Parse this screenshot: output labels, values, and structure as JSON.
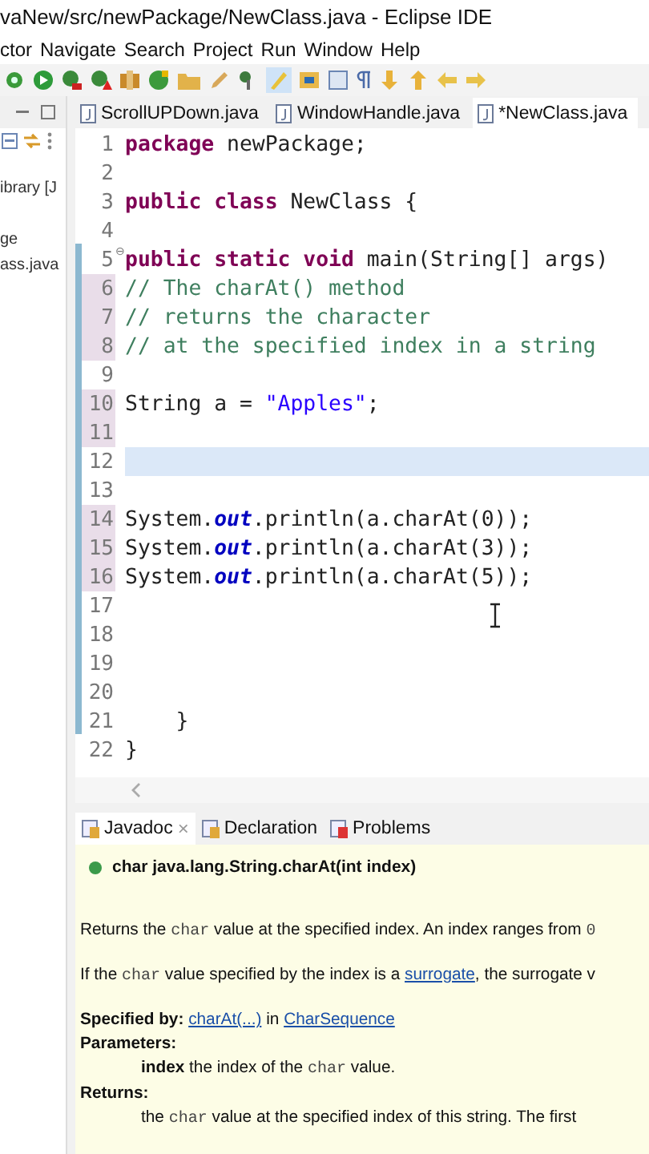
{
  "window": {
    "title": "vaNew/src/newPackage/NewClass.java - Eclipse IDE"
  },
  "menu": [
    "ctor",
    "Navigate",
    "Search",
    "Project",
    "Run",
    "Window",
    "Help"
  ],
  "explorer": {
    "items": [
      "ibrary [J",
      "ge",
      "ass.java"
    ]
  },
  "editor_tabs": [
    {
      "label": "ScrollUPDown.java",
      "selected": false
    },
    {
      "label": "WindowHandle.java",
      "selected": false
    },
    {
      "label": "*NewClass.java",
      "selected": true
    }
  ],
  "code": [
    {
      "number": "1",
      "changed": false,
      "current": false,
      "tokens": [
        {
          "kind": "kw",
          "text": "package"
        },
        {
          "kind": "plain",
          "text": " newPackage;"
        }
      ]
    },
    {
      "number": "2",
      "changed": false,
      "current": false
    },
    {
      "number": "3",
      "changed": false,
      "current": false,
      "tokens": [
        {
          "kind": "kw",
          "text": "public class"
        },
        {
          "kind": "plain",
          "text": " NewClass {"
        }
      ]
    },
    {
      "number": "4",
      "changed": false,
      "current": false
    },
    {
      "number": "5",
      "changed": false,
      "current": false,
      "fold": "⊖",
      "tokens": [
        {
          "kind": "kw",
          "text": "public static void"
        },
        {
          "kind": "plain",
          "text": " main(String[] args)"
        }
      ]
    },
    {
      "number": "6",
      "changed": true,
      "current": false,
      "tokens": [
        {
          "kind": "comment",
          "text": "// The charAt() method"
        }
      ]
    },
    {
      "number": "7",
      "changed": true,
      "current": false,
      "tokens": [
        {
          "kind": "comment",
          "text": "// returns the character"
        }
      ]
    },
    {
      "number": "8",
      "changed": true,
      "current": false,
      "tokens": [
        {
          "kind": "comment",
          "text": "// at the specified index in a string"
        }
      ]
    },
    {
      "number": "9",
      "changed": false,
      "current": false
    },
    {
      "number": "10",
      "changed": true,
      "current": false,
      "tokens": [
        {
          "kind": "plain",
          "text": "String a = "
        },
        {
          "kind": "string",
          "text": "\"Apples\""
        },
        {
          "kind": "plain",
          "text": ";"
        }
      ]
    },
    {
      "number": "11",
      "changed": true,
      "current": false
    },
    {
      "number": "12",
      "changed": false,
      "current": true
    },
    {
      "number": "13",
      "changed": false,
      "current": false
    },
    {
      "number": "14",
      "changed": true,
      "current": false,
      "tokens": [
        {
          "kind": "plain",
          "text": "System."
        },
        {
          "kind": "field",
          "text": "out"
        },
        {
          "kind": "plain",
          "text": ".println(a.charAt(0));"
        }
      ]
    },
    {
      "number": "15",
      "changed": true,
      "current": false,
      "tokens": [
        {
          "kind": "plain",
          "text": "System."
        },
        {
          "kind": "field",
          "text": "out"
        },
        {
          "kind": "plain",
          "text": ".println(a.charAt(3));"
        }
      ]
    },
    {
      "number": "16",
      "changed": true,
      "current": false,
      "tokens": [
        {
          "kind": "plain",
          "text": "System."
        },
        {
          "kind": "field",
          "text": "out"
        },
        {
          "kind": "plain",
          "text": ".println(a.charAt(5));"
        }
      ]
    },
    {
      "number": "17",
      "changed": false,
      "current": false
    },
    {
      "number": "18",
      "changed": false,
      "current": false
    },
    {
      "number": "19",
      "changed": false,
      "current": false
    },
    {
      "number": "20",
      "changed": false,
      "current": false
    },
    {
      "number": "21",
      "changed": false,
      "current": false,
      "tokens": [
        {
          "kind": "plain",
          "text": "    }"
        }
      ]
    },
    {
      "number": "22",
      "changed": false,
      "current": false,
      "tokens": [
        {
          "kind": "plain",
          "text": "}"
        }
      ]
    }
  ],
  "bottom_tabs": [
    {
      "label": "Javadoc",
      "selected": true,
      "close": "×"
    },
    {
      "label": "Declaration",
      "selected": false
    },
    {
      "label": "Problems",
      "selected": false
    }
  ],
  "javadoc": {
    "signature": "char java.lang.String.charAt(int index)",
    "paragraphs": [
      {
        "kind": "text",
        "segments": [
          {
            "kind": "text",
            "text": "Returns the "
          },
          {
            "kind": "code",
            "text": "char"
          },
          {
            "kind": "text",
            "text": " value at the specified index. An index ranges from "
          },
          {
            "kind": "code",
            "text": "0"
          }
        ]
      },
      {
        "kind": "text",
        "segments": [
          {
            "kind": "text",
            "text": "If the "
          },
          {
            "kind": "code",
            "text": "char"
          },
          {
            "kind": "text",
            "text": " value specified by the index is a "
          },
          {
            "kind": "link",
            "text": "surrogate"
          },
          {
            "kind": "text",
            "text": ", the surrogate v"
          }
        ]
      },
      {
        "kind": "heading",
        "segments": [
          {
            "kind": "bold",
            "text": "Specified by: "
          },
          {
            "kind": "link",
            "text": "charAt(...)"
          },
          {
            "kind": "text",
            "text": " in "
          },
          {
            "kind": "link",
            "text": "CharSequence"
          }
        ]
      },
      {
        "kind": "heading",
        "segments": [
          {
            "kind": "bold",
            "text": "Parameters:"
          }
        ]
      },
      {
        "kind": "indent",
        "segments": [
          {
            "kind": "bold",
            "text": "index"
          },
          {
            "kind": "text",
            "text": " the index of the "
          },
          {
            "kind": "code",
            "text": "char"
          },
          {
            "kind": "text",
            "text": " value."
          }
        ]
      },
      {
        "kind": "heading",
        "segments": [
          {
            "kind": "bold",
            "text": "Returns:"
          }
        ]
      },
      {
        "kind": "indent",
        "segments": [
          {
            "kind": "text",
            "text": "the "
          },
          {
            "kind": "code",
            "text": "char"
          },
          {
            "kind": "text",
            "text": " value at the specified index of this string. The first"
          }
        ]
      }
    ]
  }
}
